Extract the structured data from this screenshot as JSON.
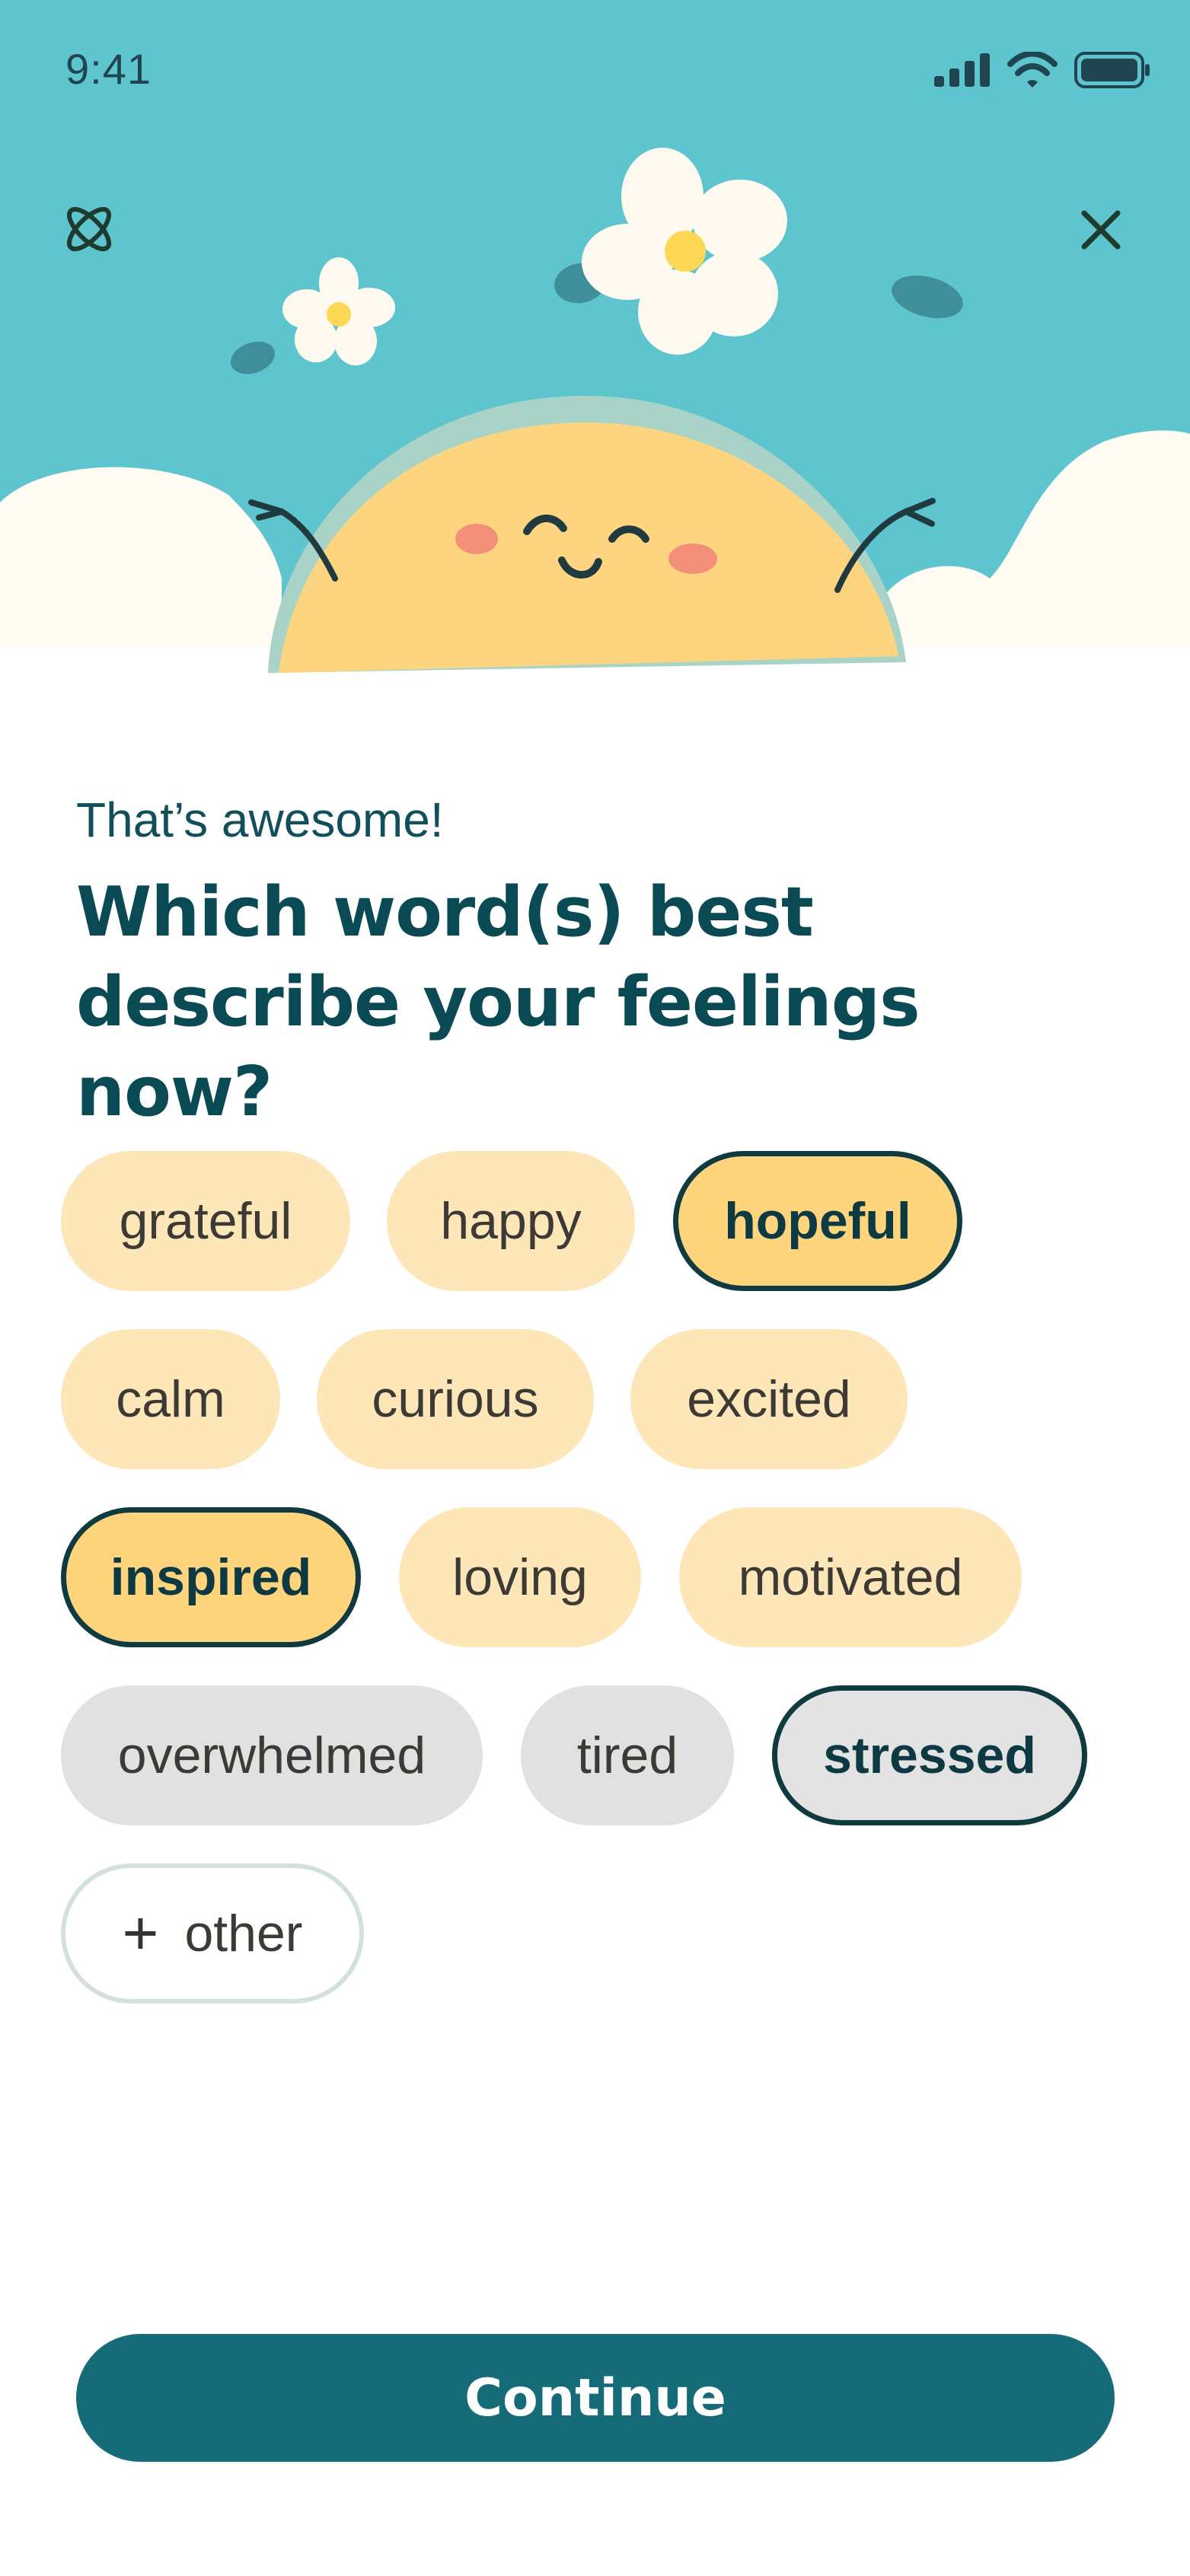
{
  "status_bar": {
    "time": "9:41"
  },
  "header": {
    "subtitle": "That’s awesome!",
    "title": "Which word(s) best describe your feelings now?"
  },
  "chips": [
    {
      "label": "grateful",
      "tone": "warm",
      "selected": false
    },
    {
      "label": "happy",
      "tone": "warm",
      "selected": false
    },
    {
      "label": "hopeful",
      "tone": "warm",
      "selected": true
    },
    {
      "label": "calm",
      "tone": "warm",
      "selected": false
    },
    {
      "label": "curious",
      "tone": "warm",
      "selected": false
    },
    {
      "label": "excited",
      "tone": "warm",
      "selected": false
    },
    {
      "label": "inspired",
      "tone": "warm",
      "selected": true
    },
    {
      "label": "loving",
      "tone": "warm",
      "selected": false
    },
    {
      "label": "motivated",
      "tone": "warm",
      "selected": false
    },
    {
      "label": "overwhelmed",
      "tone": "gray",
      "selected": false
    },
    {
      "label": "tired",
      "tone": "gray",
      "selected": false
    },
    {
      "label": "stressed",
      "tone": "gray",
      "selected": true
    }
  ],
  "other_chip": {
    "label": "other"
  },
  "continue_button": {
    "label": "Continue"
  },
  "colors": {
    "sky": "#5ec5cf",
    "sun": "#fdd581",
    "primary": "#166b79",
    "chip_warm": "#fde7b8",
    "chip_gray": "#e1e1e1"
  },
  "icons": {
    "logo": "atom-icon",
    "close": "close-icon",
    "signal": "signal-icon",
    "wifi": "wifi-icon",
    "battery": "battery-icon"
  }
}
